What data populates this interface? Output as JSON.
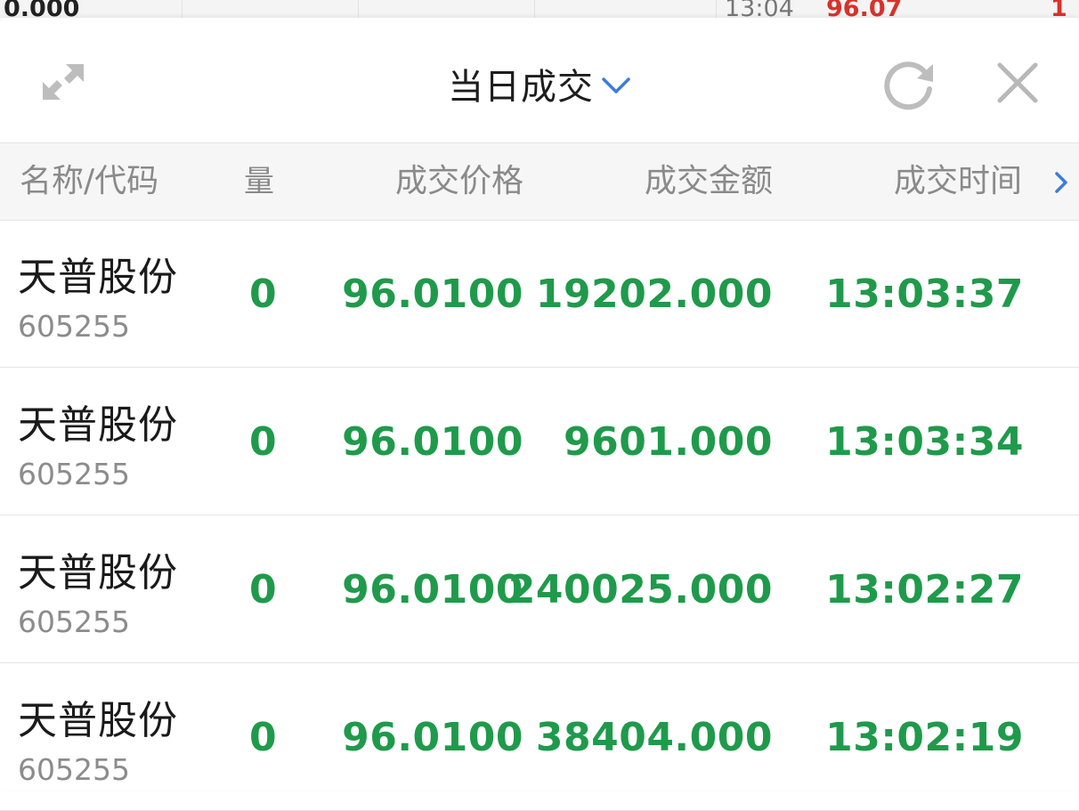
{
  "background": {
    "left_text": "0.000",
    "time_text": "13:04",
    "price_text": "96.07",
    "right_text": "1"
  },
  "header": {
    "title": "当日成交"
  },
  "columns": {
    "name": "名称/代码",
    "volume": "量",
    "price": "成交价格",
    "amount": "成交金额",
    "time": "成交时间"
  },
  "trades": [
    {
      "name": "天普股份",
      "code": "605255",
      "volume": "0",
      "price": "96.0100",
      "amount": "19202.000",
      "time": "13:03:37"
    },
    {
      "name": "天普股份",
      "code": "605255",
      "volume": "0",
      "price": "96.0100",
      "amount": "9601.000",
      "time": "13:03:34"
    },
    {
      "name": "天普股份",
      "code": "605255",
      "volume": "0",
      "price": "96.0100",
      "amount": "240025.000",
      "time": "13:02:27"
    },
    {
      "name": "天普股份",
      "code": "605255",
      "volume": "0",
      "price": "96.0100",
      "amount": "38404.000",
      "time": "13:02:19"
    }
  ],
  "colors": {
    "up_green": "#1f9a4b",
    "price_red": "#d8312b",
    "accent_blue": "#3b7ddd",
    "icon_gray": "#b8b8b8"
  },
  "icons": {
    "expand": "expand-icon",
    "dropdown": "chevron-down-icon",
    "refresh": "refresh-icon",
    "close": "close-icon",
    "more_columns": "chevron-right-icon"
  }
}
